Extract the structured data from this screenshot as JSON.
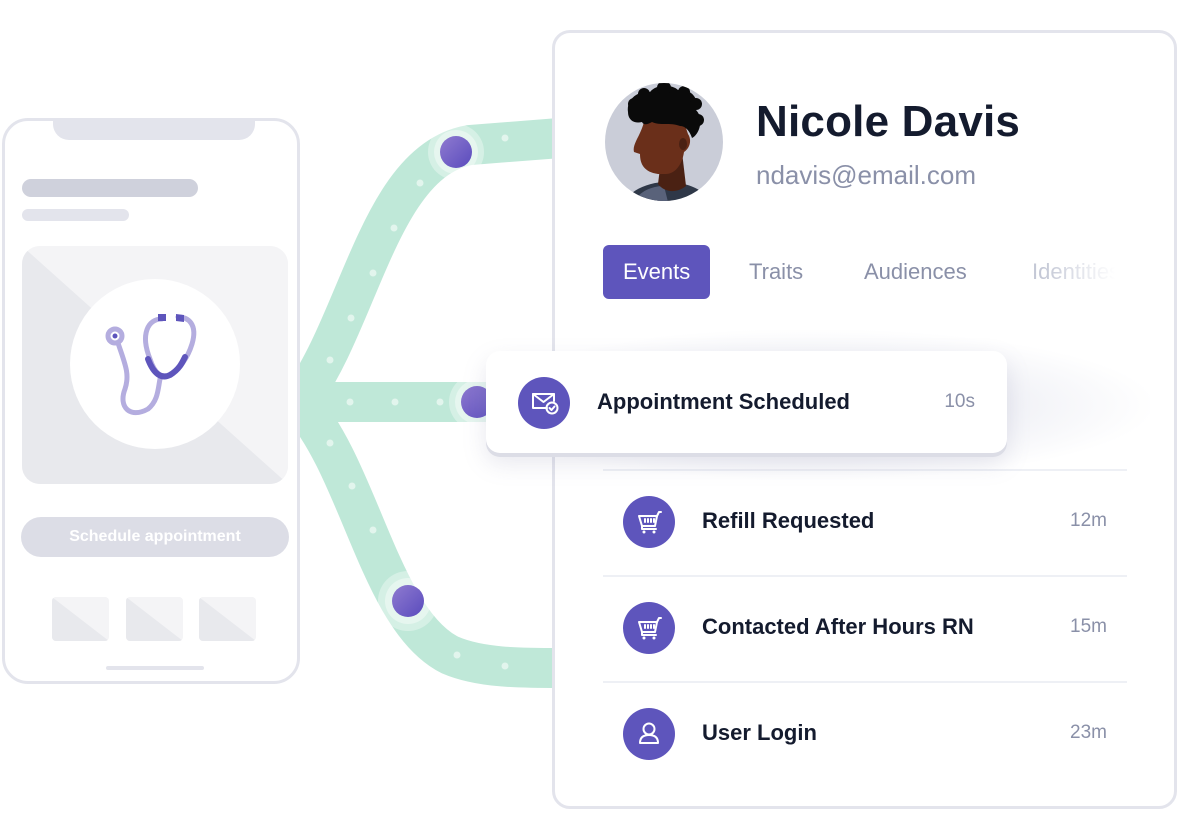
{
  "colors": {
    "accent": "#5e55bc",
    "connector": "#bfe8d8",
    "text_primary": "#141b2e",
    "text_secondary": "#8a90a8",
    "skeleton": "#e3e4ec"
  },
  "phone": {
    "illustration_icon": "stethoscope-icon",
    "cta_label": "Schedule appointment"
  },
  "profile": {
    "name": "Nicole Davis",
    "email": "ndavis@email.com",
    "avatar": "avatar-illustration"
  },
  "tabs": [
    {
      "label": "Events",
      "active": true
    },
    {
      "label": "Traits",
      "active": false
    },
    {
      "label": "Audiences",
      "active": false
    },
    {
      "label": "Identities",
      "active": false
    }
  ],
  "highlighted_event": {
    "icon": "mail-check-icon",
    "label": "Appointment Scheduled",
    "time": "10s"
  },
  "events": [
    {
      "icon": "cart-icon",
      "label": "Refill Requested",
      "time": "12m"
    },
    {
      "icon": "cart-icon",
      "label": "Contacted After Hours RN",
      "time": "15m"
    },
    {
      "icon": "user-icon",
      "label": "User Login",
      "time": "23m"
    }
  ]
}
